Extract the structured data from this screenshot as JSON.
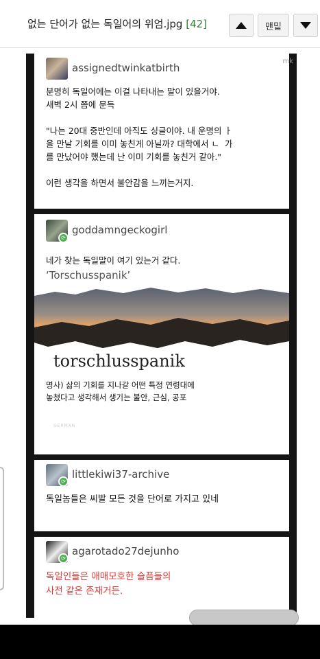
{
  "header": {
    "title": "없는 단어가 없는 독일어의 위엄.jpg",
    "count": "[42]",
    "bottom_label": "맨밑",
    "icons": {
      "up": "triangle-up-icon",
      "down": "triangle-down-icon"
    }
  },
  "colors": {
    "count": "#2e7d32",
    "reblog": "#4caf50",
    "red_text": "#e53935"
  },
  "post": {
    "watermark": "mk",
    "card1": {
      "username": "assignedtwinkatbirth",
      "text": "분명히 독일어에는 이걸 나타내는 말이 있을거야.\n새벽 2시 쯤에 문득\n\n\"나는 20대 중반인데 아직도 싱글이야. 내 운명의 ㅏ\n을 만날 기회를 이미 놓친게 아닐까? 대학에서 ㄴ  가\n를 만났어야 했는데 난 이미 기회를 놓친거 같아.\"\n\n이런 생각을 하면서 불안감을 느끼는거지."
    },
    "card2": {
      "username": "goddamngeckogirl",
      "text": "네가 찾는 독일말이 여기 있는거 같다.",
      "quote": "‘Torschusspanik’",
      "word": "torschlusspanik",
      "definition": "명사) 삶의 기회를 지나갈 어떤 특정 연령대에\n놓쳤다고 생각해서 생기는 불안, 근심, 공포",
      "footnote": "GERMAN"
    },
    "card3": {
      "username": "littlekiwi37-archive",
      "text": "독일놈들은 씨발 모든 것을 단어로 가지고 있네"
    },
    "card4": {
      "username": "agarotado27dejunho",
      "text": "독일인들은 애매모호한 슬픔들의\n사전 같은 존재거든."
    }
  }
}
